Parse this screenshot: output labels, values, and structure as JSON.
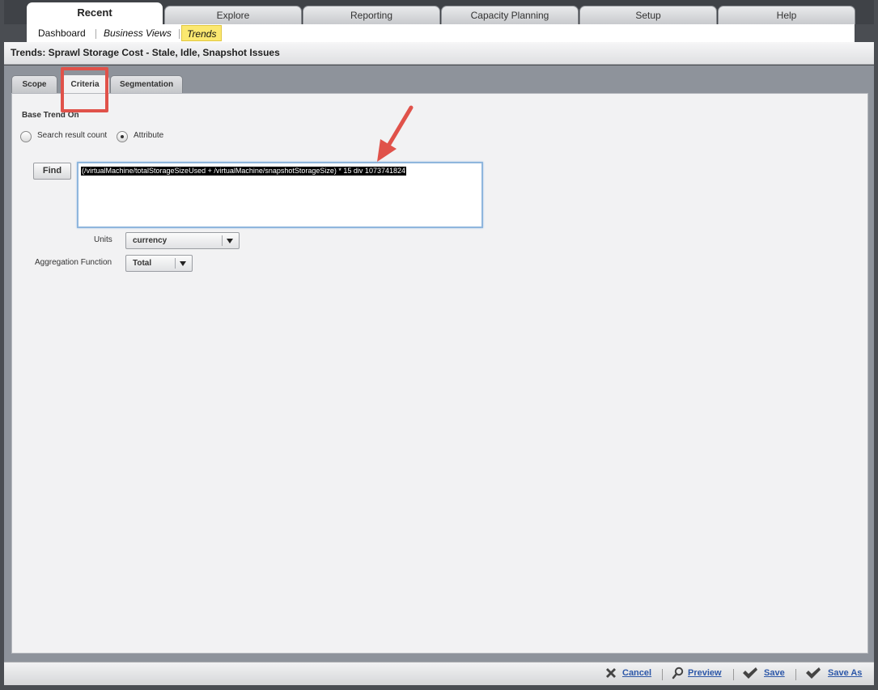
{
  "main_tabs": [
    {
      "label": "Recent",
      "active": true
    },
    {
      "label": "Explore"
    },
    {
      "label": "Reporting"
    },
    {
      "label": "Capacity Planning"
    },
    {
      "label": "Setup"
    },
    {
      "label": "Help"
    }
  ],
  "sub_nav": [
    {
      "label": "Dashboard"
    },
    {
      "label": "Business Views"
    },
    {
      "label": "Trends",
      "selected": true
    }
  ],
  "page_title": "Trends:  Sprawl Storage Cost - Stale, Idle, Snapshot Issues",
  "panel_tabs": [
    {
      "label": "Scope"
    },
    {
      "label": "Criteria",
      "active": true
    },
    {
      "label": "Segmentation"
    }
  ],
  "criteria": {
    "base_trend_label": "Base Trend On",
    "radio_options": [
      {
        "label": "Search result count",
        "selected": false
      },
      {
        "label": "Attribute",
        "selected": true
      }
    ],
    "find_button": "Find",
    "expression": "(/virtualMachine/totalStorageSizeUsed + /virtualMachine/snapshotStorageSize) * 15 div 1073741824",
    "units_label": "Units",
    "units_value": "currency",
    "aggregation_label": "Aggregation Function",
    "aggregation_value": "Total"
  },
  "footer": {
    "cancel": "Cancel",
    "preview": "Preview",
    "save": "Save",
    "save_as": "Save As"
  },
  "colors": {
    "highlight": "#e0524a",
    "link": "#2c57a8",
    "selected_subnav": "#fbe870"
  }
}
